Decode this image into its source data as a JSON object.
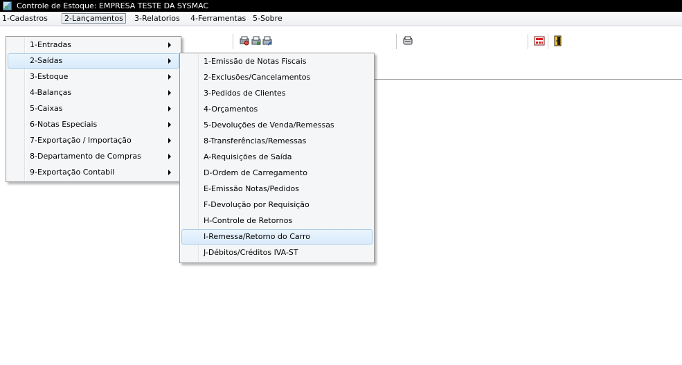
{
  "window": {
    "title": "Controle de Estoque: EMPRESA TESTE DA SYSMAC"
  },
  "menubar": [
    {
      "label": "1-Cadastros"
    },
    {
      "label": "2-Lançamentos"
    },
    {
      "label": "3-Relatorios"
    },
    {
      "label": "4-Ferramentas"
    },
    {
      "label": "5-Sobre"
    }
  ],
  "lancamentos_menu": [
    {
      "label": "1-Entradas"
    },
    {
      "label": "2-Saídas"
    },
    {
      "label": "3-Estoque"
    },
    {
      "label": "4-Balanças"
    },
    {
      "label": "5-Caixas"
    },
    {
      "label": "6-Notas Especiais"
    },
    {
      "label": "7-Exportação / Importação"
    },
    {
      "label": "8-Departamento de Compras"
    },
    {
      "label": "9-Exportação Contabil"
    }
  ],
  "saidas_submenu": [
    {
      "label": "1-Emissão de Notas Fiscais"
    },
    {
      "label": "2-Exclusões/Cancelamentos"
    },
    {
      "label": "3-Pedidos de Clientes"
    },
    {
      "label": "4-Orçamentos"
    },
    {
      "label": "5-Devoluções de Venda/Remessas"
    },
    {
      "label": "8-Transferências/Remessas"
    },
    {
      "label": "A-Requisições de Saída"
    },
    {
      "label": "D-Ordem de Carregamento"
    },
    {
      "label": "E-Emissão Notas/Pedidos"
    },
    {
      "label": "F-Devolução por Requisição"
    },
    {
      "label": "H-Controle de Retornos"
    },
    {
      "label": "I-Remessa/Retorno do Carro"
    },
    {
      "label": "J-Débitos/Créditos IVA-ST"
    }
  ],
  "toolbar_icons": [
    "print-preview-icon",
    "print-settings-icon",
    "print-setup-icon",
    "report-icon",
    "calculator-icon",
    "exit-door-icon"
  ]
}
